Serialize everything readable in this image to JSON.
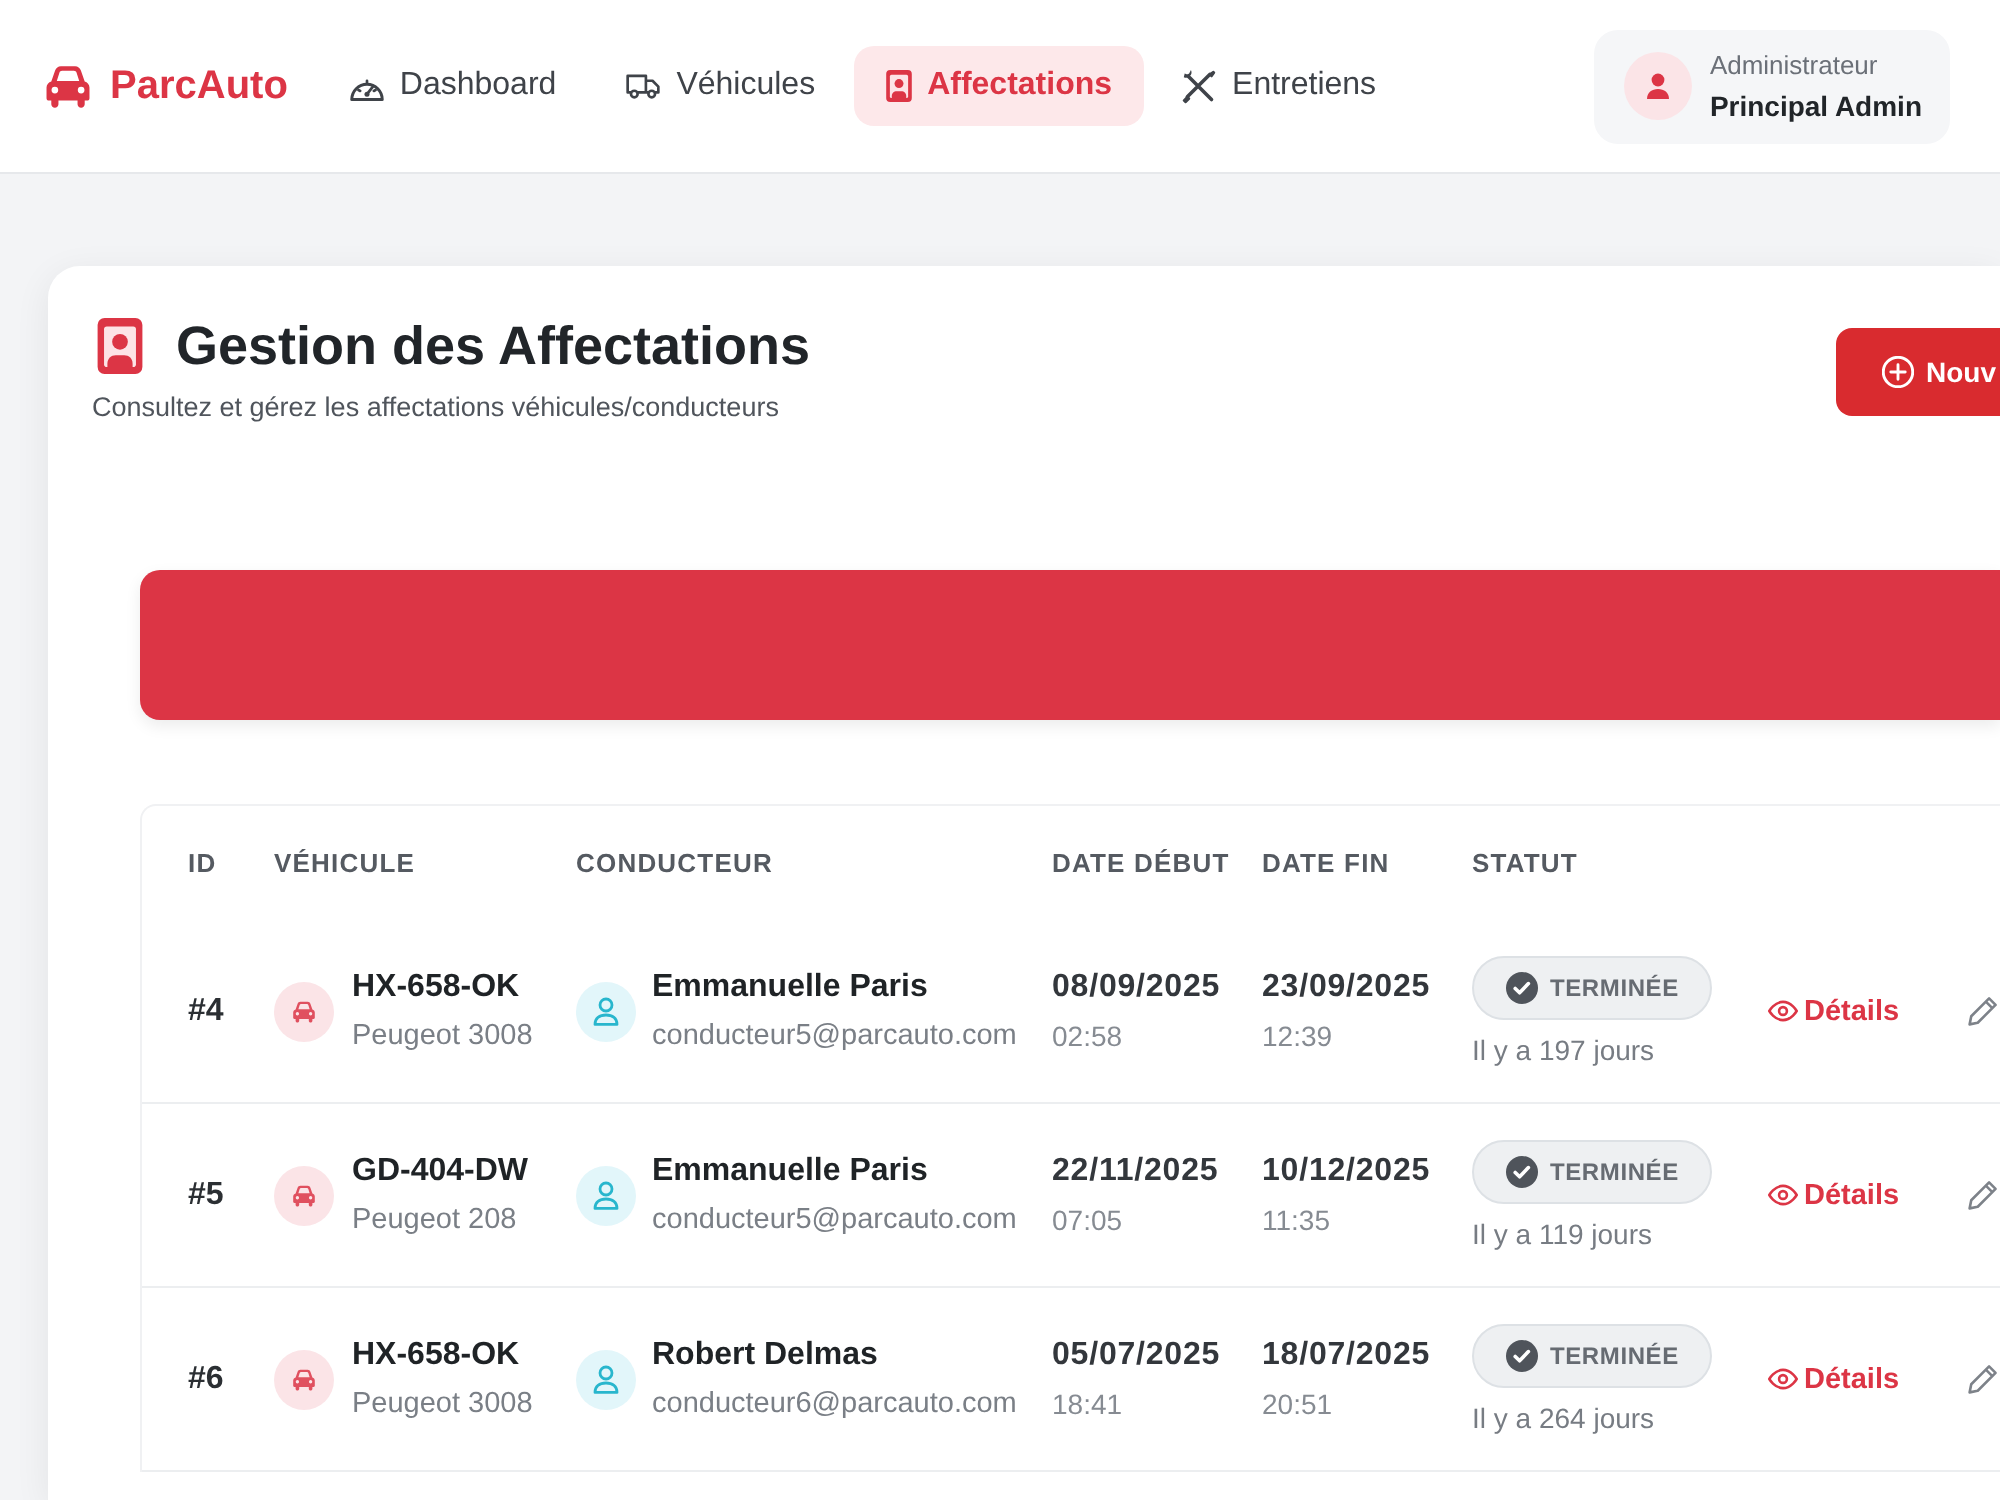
{
  "header": {
    "logo": "ParcAuto",
    "nav": [
      {
        "label": "Dashboard",
        "selected": false
      },
      {
        "label": "Véhicules",
        "selected": false
      },
      {
        "label": "Affectations",
        "selected": true
      },
      {
        "label": "Entretiens",
        "selected": false
      }
    ],
    "user": {
      "role": "Administrateur",
      "name": "Principal Admin"
    }
  },
  "page": {
    "title": "Gestion des Affectations",
    "subtitle": "Consultez et gérez les affectations véhicules/conducteurs",
    "new_button": "Nouv"
  },
  "table": {
    "columns": [
      "ID",
      "VÉHICULE",
      "CONDUCTEUR",
      "DATE DÉBUT",
      "DATE FIN",
      "STATUT"
    ],
    "rows": [
      {
        "id": "#4",
        "vehicle": {
          "plate": "HX-658-OK",
          "model": "Peugeot 3008"
        },
        "driver": {
          "name": "Emmanuelle Paris",
          "email": "conducteur5@parcauto.com"
        },
        "start": {
          "date": "08/09/2025",
          "time": "02:58"
        },
        "end": {
          "date": "23/09/2025",
          "time": "12:39"
        },
        "status": {
          "label": "TERMINÉE",
          "kind": "finished"
        },
        "elapsed": "Il y a 197 jours",
        "details": "Détails"
      },
      {
        "id": "#5",
        "vehicle": {
          "plate": "GD-404-DW",
          "model": "Peugeot 208"
        },
        "driver": {
          "name": "Emmanuelle Paris",
          "email": "conducteur5@parcauto.com"
        },
        "start": {
          "date": "22/11/2025",
          "time": "07:05"
        },
        "end": {
          "date": "10/12/2025",
          "time": "11:35"
        },
        "status": {
          "label": "TERMINÉE",
          "kind": "finished"
        },
        "elapsed": "Il y a 119 jours",
        "details": "Détails"
      },
      {
        "id": "#6",
        "vehicle": {
          "plate": "HX-658-OK",
          "model": "Peugeot 3008"
        },
        "driver": {
          "name": "Robert Delmas",
          "email": "conducteur6@parcauto.com"
        },
        "start": {
          "date": "05/07/2025",
          "time": "18:41"
        },
        "end": {
          "date": "18/07/2025",
          "time": "20:51"
        },
        "status": {
          "label": "TERMINÉE",
          "kind": "finished"
        },
        "elapsed": "Il y a 264 jours",
        "details": "Détails"
      }
    ]
  }
}
